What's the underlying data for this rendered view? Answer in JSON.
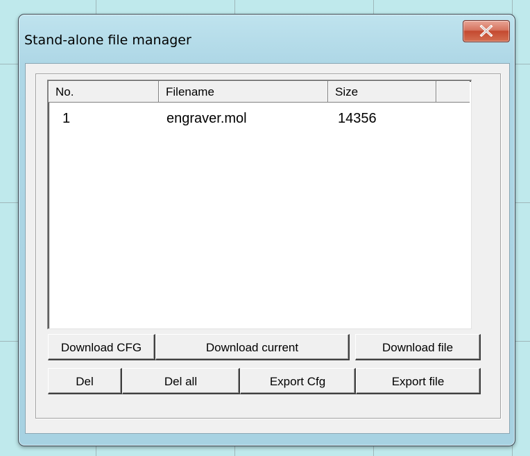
{
  "window": {
    "title": "Stand-alone file manager",
    "close_label": "X"
  },
  "file_list": {
    "columns": [
      "No.",
      "Filename",
      "Size",
      ""
    ],
    "rows": [
      {
        "no": "1",
        "filename": "engraver.mol",
        "size": "14356"
      }
    ]
  },
  "buttons": {
    "row1": [
      "Download CFG",
      "Download current",
      "Download file"
    ],
    "row2": [
      "Del",
      "Del all",
      "Export Cfg",
      "Export file"
    ]
  },
  "colors": {
    "desktop_bg": "#bfe9ec",
    "window_frame": "#aed7e6",
    "close_button": "#c44a30",
    "dialog_bg": "#f0f0f0"
  }
}
